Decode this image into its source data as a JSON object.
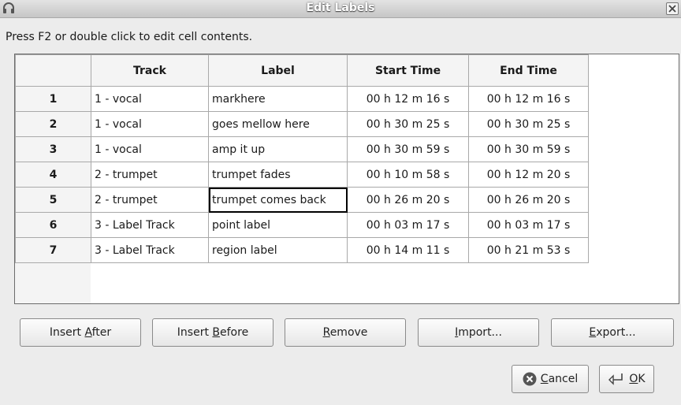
{
  "window": {
    "title": "Edit Labels"
  },
  "hint": "Press F2 or double click to edit cell contents.",
  "columns": [
    "Track",
    "Label",
    "Start Time",
    "End Time"
  ],
  "rows": [
    {
      "num": "1",
      "track": "1 - vocal",
      "label": "markhere",
      "start": "00 h 12 m 16 s",
      "end": "00 h 12 m 16 s"
    },
    {
      "num": "2",
      "track": "1 - vocal",
      "label": "goes mellow here",
      "start": "00 h 30 m 25 s",
      "end": "00 h 30 m 25 s"
    },
    {
      "num": "3",
      "track": "1 - vocal",
      "label": "amp it up",
      "start": "00 h 30 m 59 s",
      "end": "00 h 30 m 59 s"
    },
    {
      "num": "4",
      "track": "2 - trumpet",
      "label": "trumpet fades",
      "start": "00 h 10 m 58 s",
      "end": "00 h 12 m 20 s"
    },
    {
      "num": "5",
      "track": "2 - trumpet",
      "label": "trumpet comes back",
      "start": "00 h 26 m 20 s",
      "end": "00 h 26 m 20 s"
    },
    {
      "num": "6",
      "track": "3 - Label Track",
      "label": "point label",
      "start": "00 h 03 m 17 s",
      "end": "00 h 03 m 17 s"
    },
    {
      "num": "7",
      "track": "3 - Label Track",
      "label": "region label",
      "start": "00 h 14 m 11 s",
      "end": "00 h 21 m 53 s"
    }
  ],
  "selected_cell": {
    "row": 5,
    "column": "Label"
  },
  "buttons": {
    "insert_after": {
      "pre": "Insert ",
      "mn": "A",
      "post": "fter"
    },
    "insert_before": {
      "pre": "Insert ",
      "mn": "B",
      "post": "efore"
    },
    "remove": {
      "pre": "",
      "mn": "R",
      "post": "emove"
    },
    "import": {
      "pre": "",
      "mn": "I",
      "post": "mport..."
    },
    "export": {
      "pre": "",
      "mn": "E",
      "post": "xport..."
    },
    "cancel": {
      "pre": "",
      "mn": "C",
      "post": "ancel"
    },
    "ok": {
      "pre": "",
      "mn": "O",
      "post": "K"
    }
  },
  "icons": {
    "window": "headphones-icon",
    "close": "close-icon",
    "cancel": "cancel-circle-icon",
    "ok": "enter-arrow-icon"
  }
}
